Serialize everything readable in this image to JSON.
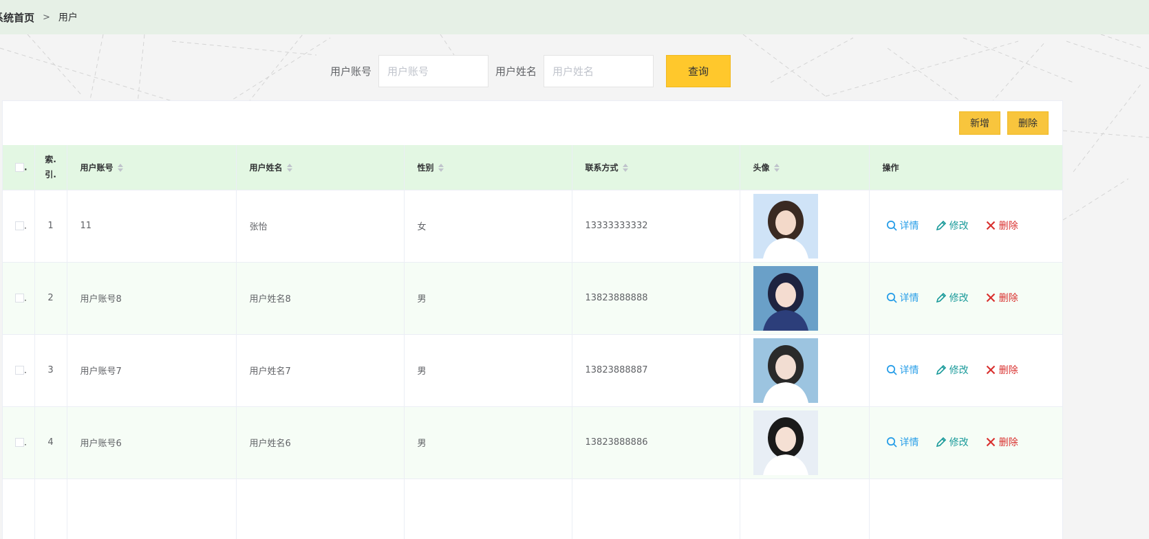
{
  "breadcrumb": {
    "home": "系统首页",
    "separator": ">",
    "current": "用户"
  },
  "search": {
    "account_label": "用户账号",
    "account_placeholder": "用户账号",
    "name_label": "用户姓名",
    "name_placeholder": "用户姓名",
    "query_button": "查询"
  },
  "toolbar": {
    "add_label": "新增",
    "delete_label": "删除"
  },
  "table": {
    "headers": {
      "index_top": "索",
      "index_bottom": "引",
      "account": "用户账号",
      "name": "用户姓名",
      "gender": "性别",
      "phone": "联系方式",
      "avatar": "头像",
      "ops": "操作"
    },
    "rows": [
      {
        "index": "1",
        "account": "11",
        "name": "张怡",
        "gender": "女",
        "phone": "13333333332"
      },
      {
        "index": "2",
        "account": "用户账号8",
        "name": "用户姓名8",
        "gender": "男",
        "phone": "13823888888"
      },
      {
        "index": "3",
        "account": "用户账号7",
        "name": "用户姓名7",
        "gender": "男",
        "phone": "13823888887"
      },
      {
        "index": "4",
        "account": "用户账号6",
        "name": "用户姓名6",
        "gender": "男",
        "phone": "13823888886"
      }
    ],
    "ops": {
      "detail": "详情",
      "edit": "修改",
      "delete": "删除"
    }
  },
  "colors": {
    "accent_yellow": "#ffc82c",
    "header_green": "#e3f7e3",
    "detail_blue": "#2a9fe8",
    "edit_teal": "#199a9a",
    "delete_red": "#d9312f"
  },
  "icons": {
    "detail": "search-icon",
    "edit": "pencil-icon",
    "delete": "close-icon"
  }
}
